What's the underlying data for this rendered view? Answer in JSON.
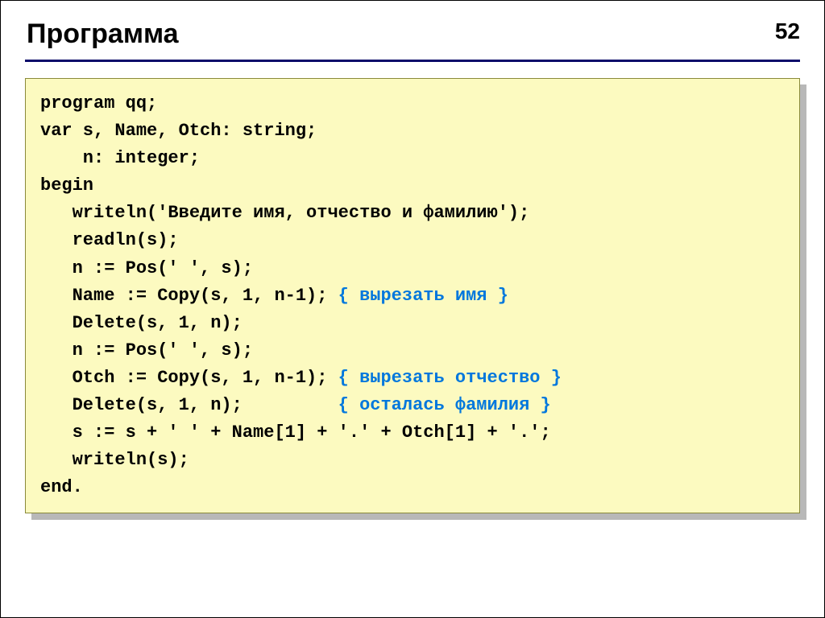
{
  "header": {
    "title": "Программа",
    "page_number": "52"
  },
  "code": {
    "lines": [
      {
        "text": "program qq;",
        "comment": ""
      },
      {
        "text": "var s, Name, Otch: string;",
        "comment": ""
      },
      {
        "text": "    n: integer;",
        "comment": ""
      },
      {
        "text": "begin",
        "comment": ""
      },
      {
        "text": "   writeln('Введите имя, отчество и фамилию');",
        "comment": ""
      },
      {
        "text": "   readln(s);",
        "comment": ""
      },
      {
        "text": "   n := Pos(' ', s);",
        "comment": ""
      },
      {
        "text": "   Name := Copy(s, 1, n-1); ",
        "comment": "{ вырезать имя }"
      },
      {
        "text": "   Delete(s, 1, n);",
        "comment": ""
      },
      {
        "text": "   n := Pos(' ', s);",
        "comment": ""
      },
      {
        "text": "   Otch := Copy(s, 1, n-1); ",
        "comment": "{ вырезать отчество }"
      },
      {
        "text": "   Delete(s, 1, n);         ",
        "comment": "{ осталась фамилия }"
      },
      {
        "text": "   s := s + ' ' + Name[1] + '.' + Otch[1] + '.';",
        "comment": ""
      },
      {
        "text": "   writeln(s);",
        "comment": ""
      },
      {
        "text": "end.",
        "comment": ""
      }
    ]
  }
}
